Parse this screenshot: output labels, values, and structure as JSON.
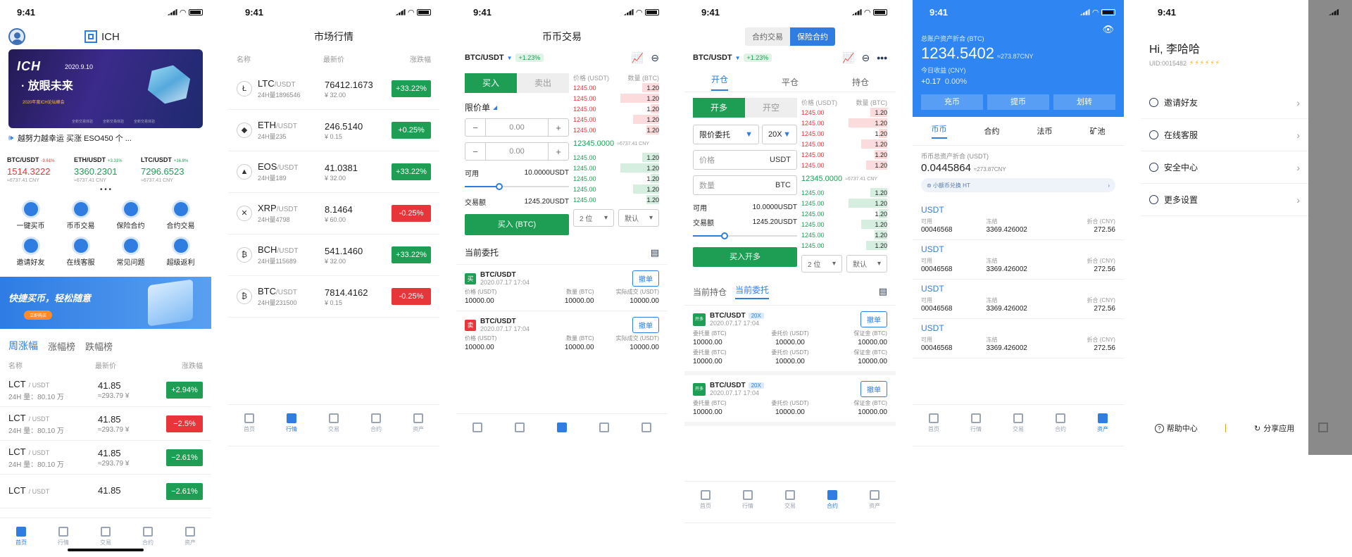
{
  "status_time": "9:41",
  "tabbar": [
    "首页",
    "行情",
    "交易",
    "合约",
    "资产"
  ],
  "home": {
    "brand": "ICH",
    "banner": {
      "logo": "ICH",
      "date": "2020.9.10",
      "slogan": "· 放眼未来",
      "sub": "2020年度ICH论坛峰会",
      "tags": [
        "全新交易体验",
        "全新交易体验",
        "全新交易体验"
      ]
    },
    "notice": "越努力越幸运 买涨 ESO450 个 ...",
    "tickers": [
      {
        "pair": "BTC/USDT",
        "chg": "-9.61%",
        "price": "1514.3222",
        "cny": "≈6737.41 CNY",
        "dir": "down"
      },
      {
        "pair": "ETH/USDT",
        "chg": "+3.31%",
        "price": "3360.2301",
        "cny": "≈6737.41 CNY",
        "dir": "up"
      },
      {
        "pair": "LTC/USDT",
        "chg": "+16.8%",
        "price": "7296.6523",
        "cny": "≈6737.41 CNY",
        "dir": "up"
      }
    ],
    "dots": "• • •",
    "quick": [
      {
        "label": "一键买币",
        "icon": "lightning-icon"
      },
      {
        "label": "币币交易",
        "icon": "exchange-icon"
      },
      {
        "label": "保险合约",
        "icon": "shield-icon"
      },
      {
        "label": "合约交易",
        "icon": "contract-icon"
      },
      {
        "label": "邀请好友",
        "icon": "invite-icon"
      },
      {
        "label": "在线客服",
        "icon": "service-icon"
      },
      {
        "label": "常见问题",
        "icon": "faq-icon"
      },
      {
        "label": "超级返利",
        "icon": "rebate-icon"
      }
    ],
    "promo": {
      "title": "快捷买币，轻松随意",
      "btn": "立即购买"
    },
    "rank_tabs": [
      "周涨幅",
      "涨幅榜",
      "跌幅榜"
    ],
    "rank_headers": [
      "名称",
      "最新价",
      "涨跌幅"
    ],
    "rank_rows": [
      {
        "name": "LCT",
        "quote": "USDT",
        "vol": "24H 量：80.10 万",
        "price": "41.85",
        "cny": "≈293.79 ¥",
        "chg": "+2.94%",
        "dir": "up"
      },
      {
        "name": "LCT",
        "quote": "USDT",
        "vol": "24H 量：80.10 万",
        "price": "41.85",
        "cny": "≈293.79 ¥",
        "chg": "−2.5%",
        "dir": "down"
      },
      {
        "name": "LCT",
        "quote": "USDT",
        "vol": "24H 量：80.10 万",
        "price": "41.85",
        "cny": "≈293.79 ¥",
        "chg": "−2.61%",
        "dir": "up"
      },
      {
        "name": "LCT",
        "quote": "USDT",
        "vol": "",
        "price": "41.85",
        "cny": "",
        "chg": "−2.61%",
        "dir": "up"
      }
    ]
  },
  "market": {
    "title": "市场行情",
    "headers": [
      "名称",
      "最新价",
      "涨跌幅"
    ],
    "rows": [
      {
        "coin": "LTC",
        "quote": "USDT",
        "vol": "24H量1896546",
        "price": "76412.1673",
        "cny": "¥ 32.00",
        "chg": "+33.22%",
        "dir": "up",
        "icon": "litecoin-icon",
        "glyph": "Ł"
      },
      {
        "coin": "ETH",
        "quote": "USDT",
        "vol": "24H量235",
        "price": "246.5140",
        "cny": "¥ 0.15",
        "chg": "+0.25%",
        "dir": "up",
        "icon": "ethereum-icon",
        "glyph": "◆"
      },
      {
        "coin": "EOS",
        "quote": "USDT",
        "vol": "24H量189",
        "price": "41.0381",
        "cny": "¥ 32.00",
        "chg": "+33.22%",
        "dir": "up",
        "icon": "eos-icon",
        "glyph": "▲"
      },
      {
        "coin": "XRP",
        "quote": "USDT",
        "vol": "24H量4798",
        "price": "8.1464",
        "cny": "¥ 60.00",
        "chg": "-0.25%",
        "dir": "down",
        "icon": "ripple-icon",
        "glyph": "✕"
      },
      {
        "coin": "BCH",
        "quote": "USDT",
        "vol": "24H量115689",
        "price": "541.1460",
        "cny": "¥ 32.00",
        "chg": "+33.22%",
        "dir": "up",
        "icon": "bitcoin-cash-icon",
        "glyph": "₿"
      },
      {
        "coin": "BTC",
        "quote": "USDT",
        "vol": "24H量231500",
        "price": "7814.4162",
        "cny": "¥ 0.15",
        "chg": "-0.25%",
        "dir": "down",
        "icon": "bitcoin-icon",
        "glyph": "₿"
      }
    ]
  },
  "spot": {
    "title": "币币交易",
    "pair": "BTC/USDT",
    "chg": "+1.23%",
    "buy": "买入",
    "sell": "卖出",
    "order_type": "限价单",
    "price_val": "0.00",
    "qty_val": "0.00",
    "avail_label": "可用",
    "avail_val": "10.0000USDT",
    "amount_label": "交易额",
    "amount_val": "1245.20USDT",
    "submit": "买入 (BTC)",
    "ob_headers": [
      "价格 (USDT)",
      "数量 (BTC)"
    ],
    "asks": [
      "1245.00",
      "1245.00",
      "1245.00",
      "1245.00",
      "1245.00"
    ],
    "bids": [
      "1245.00",
      "1245.00",
      "1245.00",
      "1245.00",
      "1245.00"
    ],
    "qtys": [
      "1.20",
      "1.20",
      "1.20",
      "1.20",
      "1.20"
    ],
    "mid_price": "12345.0000",
    "mid_cny": "≈6737.41 CNY",
    "depth": "2 位",
    "default": "默认",
    "orders_title": "当前委托",
    "orders": [
      {
        "side": "买",
        "pair": "BTC/USDT",
        "time": "2020.07.17  17:04",
        "cancel": "撤单",
        "labels": [
          "价格 (USDT)",
          "数量 (BTC)",
          "实际成交 (USDT)"
        ],
        "vals": [
          "10000.00",
          "10000.00",
          "10000.00"
        ],
        "dir": "up"
      },
      {
        "side": "卖",
        "pair": "BTC/USDT",
        "time": "2020.07.17  17:04",
        "cancel": "撤单",
        "labels": [
          "价格 (USDT)",
          "数量 (BTC)",
          "实际成交 (USDT)"
        ],
        "vals": [
          "10000.00",
          "10000.00",
          "10000.00"
        ],
        "dir": "down"
      }
    ]
  },
  "futures": {
    "toggle": [
      "合约交易",
      "保险合约"
    ],
    "pair": "BTC/USDT",
    "chg": "+1.23%",
    "tabs": [
      "开仓",
      "平仓",
      "持仓"
    ],
    "side_tabs": [
      "开多",
      "开空"
    ],
    "order_type": "限价委托",
    "leverage": "20X",
    "price_ph": "价格",
    "price_unit": "USDT",
    "qty_ph": "数量",
    "qty_unit": "BTC",
    "avail_label": "可用",
    "avail_val": "10.0000USDT",
    "amount_label": "交易额",
    "amount_val": "1245.20USDT",
    "submit": "买入开多",
    "ob_headers": [
      "价格 (USDT)",
      "数量 (BTC)"
    ],
    "asks": [
      "1245.00",
      "1245.00",
      "1245.00",
      "1245.00",
      "1245.00",
      "1245.00"
    ],
    "bids": [
      "1245.00",
      "1245.00",
      "1245.00",
      "1245.00",
      "1245.00",
      "1245.00"
    ],
    "qtys": [
      "1.20",
      "1.20",
      "1.20",
      "1.20",
      "1.20",
      "1.20"
    ],
    "mid_price": "12345.0000",
    "mid_cny": "≈6737.41 CNY",
    "depth": "2 位",
    "default": "默认",
    "list_tabs": [
      "当前持仓",
      "当前委托"
    ],
    "orders": [
      {
        "side": "开多",
        "pair": "BTC/USDT",
        "lev": "20X",
        "time": "2020.07.17  17:04",
        "cancel": "撤单",
        "l1": [
          "委托量 (BTC)",
          "委托价 (USDT)",
          "保证金 (BTC)"
        ],
        "v1": [
          "10000.00",
          "10000.00",
          "10000.00"
        ],
        "l2": [
          "委托量 (BTC)",
          "委托价 (USDT)",
          "保证金 (BTC)"
        ],
        "v2": [
          "10000.00",
          "10000.00",
          "10000.00"
        ]
      },
      {
        "side": "开多",
        "pair": "BTC/USDT",
        "lev": "20X",
        "time": "2020.07.17  17:04",
        "cancel": "撤单",
        "l1": [
          "委托量 (BTC)",
          "委托价 (USDT)",
          "保证金 (BTC)"
        ],
        "v1": [
          "10000.00",
          "10000.00",
          "10000.00"
        ]
      }
    ]
  },
  "assets": {
    "total_label": "总账户资产折合 (BTC)",
    "total_val": "1234.5402",
    "total_cny": "≈273.87CNY",
    "today_label": "今日收益 (CNY)",
    "today_val": "+0.17",
    "today_pct": "0.00%",
    "actions": [
      "充币",
      "提币",
      "划转"
    ],
    "tabs": [
      "币币",
      "合约",
      "法币",
      "矿池"
    ],
    "sub_label": "币币总资产折合 (USDT)",
    "sub_val": "0.0445864",
    "sub_cny": "≈273.87CNY",
    "swap": "小额币兑换 HT",
    "col_labels": [
      "可用",
      "冻结",
      "折合 (CNY)"
    ],
    "items": [
      {
        "coin": "USDT",
        "avail": "00046568",
        "frozen": "3369.426002",
        "cny": "272.56"
      },
      {
        "coin": "USDT",
        "avail": "00046568",
        "frozen": "3369.426002",
        "cny": "272.56"
      },
      {
        "coin": "USDT",
        "avail": "00046568",
        "frozen": "3369.426002",
        "cny": "272.56"
      },
      {
        "coin": "USDT",
        "avail": "00046568",
        "frozen": "3369.426002",
        "cny": "272.56"
      }
    ]
  },
  "profile": {
    "greeting": "Hi, 李哈哈",
    "uid": "UID:0015482",
    "menu": [
      {
        "label": "邀请好友",
        "icon": "user-icon"
      },
      {
        "label": "在线客服",
        "icon": "headset-icon"
      },
      {
        "label": "安全中心",
        "icon": "shield-icon"
      },
      {
        "label": "更多设置",
        "icon": "settings-icon"
      }
    ],
    "help": "帮助中心",
    "share": "分享应用"
  }
}
